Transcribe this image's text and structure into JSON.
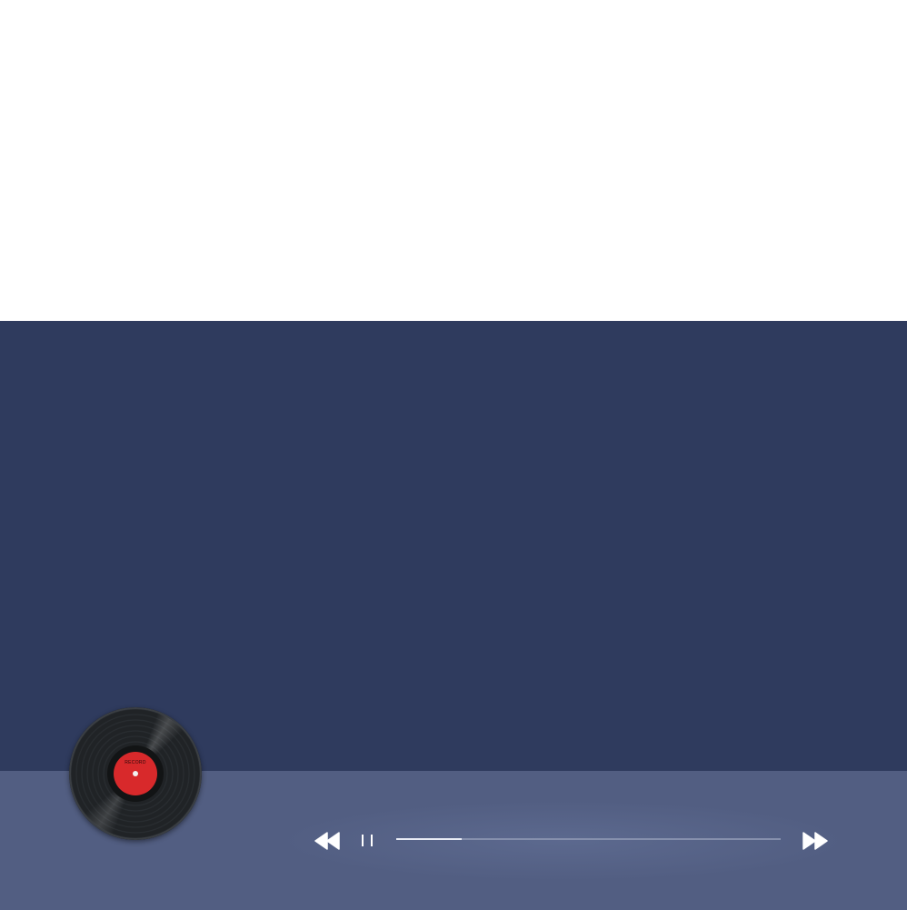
{
  "player": {
    "record": {
      "label_text": "RECORD"
    },
    "controls": {
      "rewind_icon": "rewind-icon",
      "pause_icon": "pause-icon",
      "fast_forward_icon": "fast-forward-icon"
    },
    "progress": {
      "fraction": 0.17
    }
  },
  "colors": {
    "stage_background": "#2f3b5e",
    "player_bar_background": "#525e82",
    "record_label": "#d8292b",
    "progress_fill": "#e9ecf5",
    "progress_track": "#8690ad",
    "icon": "#ffffff"
  }
}
